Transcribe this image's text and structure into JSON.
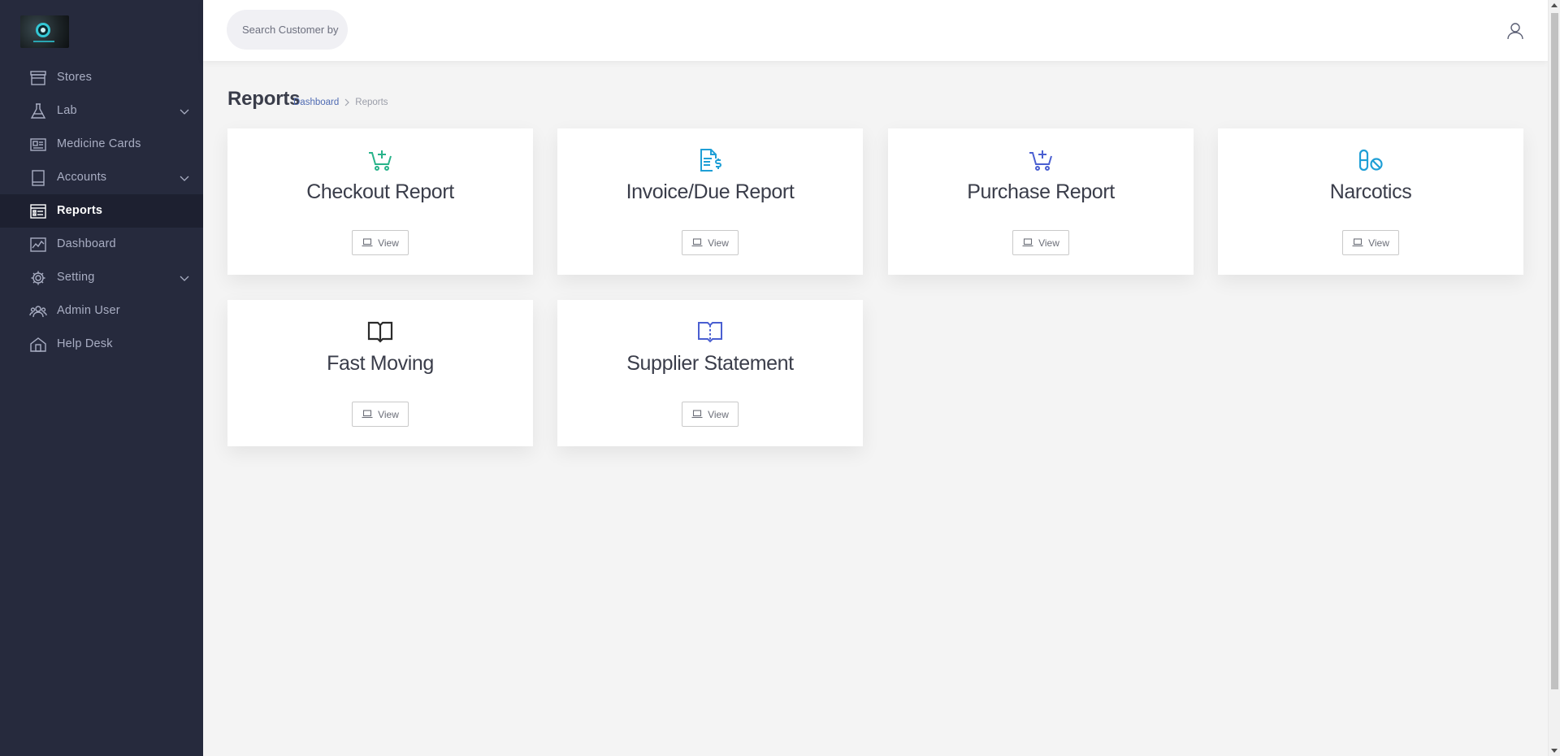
{
  "sidebar": {
    "items": [
      {
        "label": "Stores",
        "icon": "store-icon",
        "has_children": false,
        "active": false
      },
      {
        "label": "Lab",
        "icon": "flask-icon",
        "has_children": true,
        "active": false
      },
      {
        "label": "Medicine Cards",
        "icon": "id-card-icon",
        "has_children": false,
        "active": false
      },
      {
        "label": "Accounts",
        "icon": "ledger-icon",
        "has_children": true,
        "active": false
      },
      {
        "label": "Reports",
        "icon": "report-icon",
        "has_children": false,
        "active": true
      },
      {
        "label": "Dashboard",
        "icon": "chart-icon",
        "has_children": false,
        "active": false
      },
      {
        "label": "Setting",
        "icon": "gear-icon",
        "has_children": true,
        "active": false
      },
      {
        "label": "Admin User",
        "icon": "users-icon",
        "has_children": false,
        "active": false
      },
      {
        "label": "Help Desk",
        "icon": "help-desk-icon",
        "has_children": false,
        "active": false
      }
    ]
  },
  "topbar": {
    "search_placeholder": "Search Customer by"
  },
  "page": {
    "title": "Reports",
    "breadcrumb": {
      "link": "Dashboard",
      "current": "Reports"
    }
  },
  "cards": [
    {
      "title": "Checkout Report",
      "icon": "cart-plus-icon",
      "icon_color": "#28b38a",
      "button": "View"
    },
    {
      "title": "Invoice/Due Report",
      "icon": "invoice-dollar-icon",
      "icon_color": "#1f9fd6",
      "button": "View"
    },
    {
      "title": "Purchase Report",
      "icon": "cart-plus-icon",
      "icon_color": "#4a5fd1",
      "button": "View"
    },
    {
      "title": "Narcotics",
      "icon": "pill-cancel-icon",
      "icon_color": "#1f9fd6",
      "button": "View"
    },
    {
      "title": "Fast Moving",
      "icon": "open-book-icon",
      "icon_color": "#2b2b2b",
      "button": "View"
    },
    {
      "title": "Supplier Statement",
      "icon": "open-book-icon",
      "icon_color": "#4a5fd1",
      "button": "View"
    }
  ],
  "colors": {
    "sidebar_bg": "#262a3d",
    "sidebar_active_bg": "#1d2030",
    "page_bg": "#f4f4f4",
    "link": "#4f6bb3"
  }
}
